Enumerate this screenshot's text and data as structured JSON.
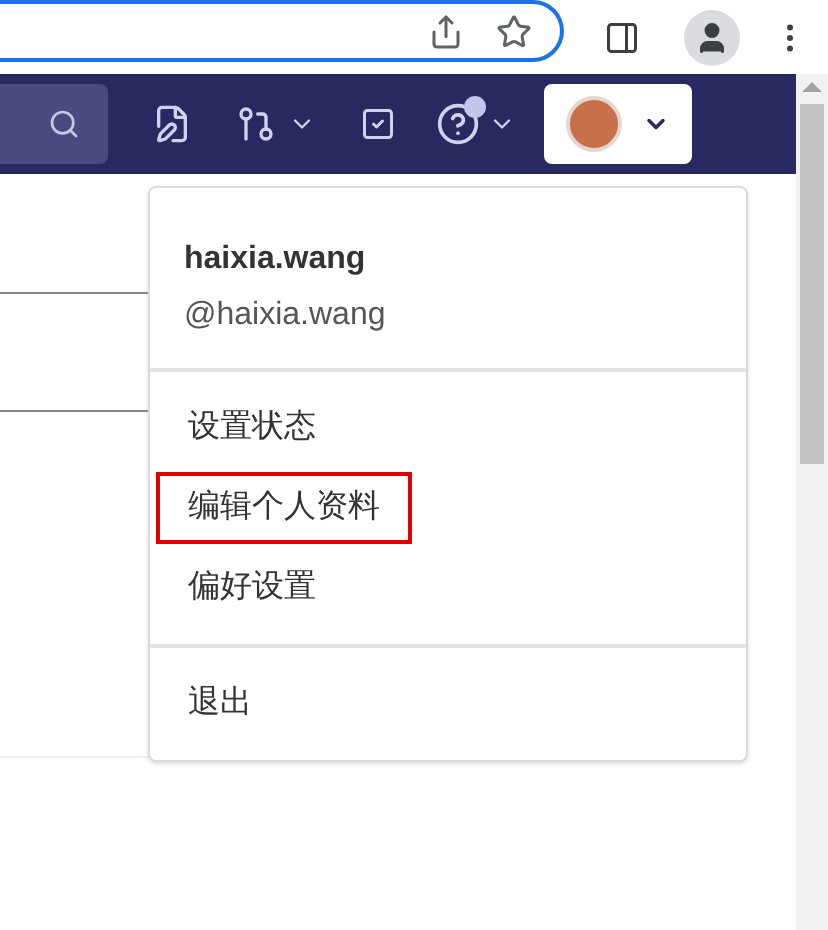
{
  "user": {
    "name": "haixia.wang",
    "handle": "@haixia.wang"
  },
  "menu_sections": [
    {
      "items": [
        {
          "label": "设置状态",
          "highlighted": false
        },
        {
          "label": "编辑个人资料",
          "highlighted": true
        },
        {
          "label": "偏好设置",
          "highlighted": false
        }
      ]
    },
    {
      "items": [
        {
          "label": "退出",
          "highlighted": false
        }
      ]
    }
  ]
}
